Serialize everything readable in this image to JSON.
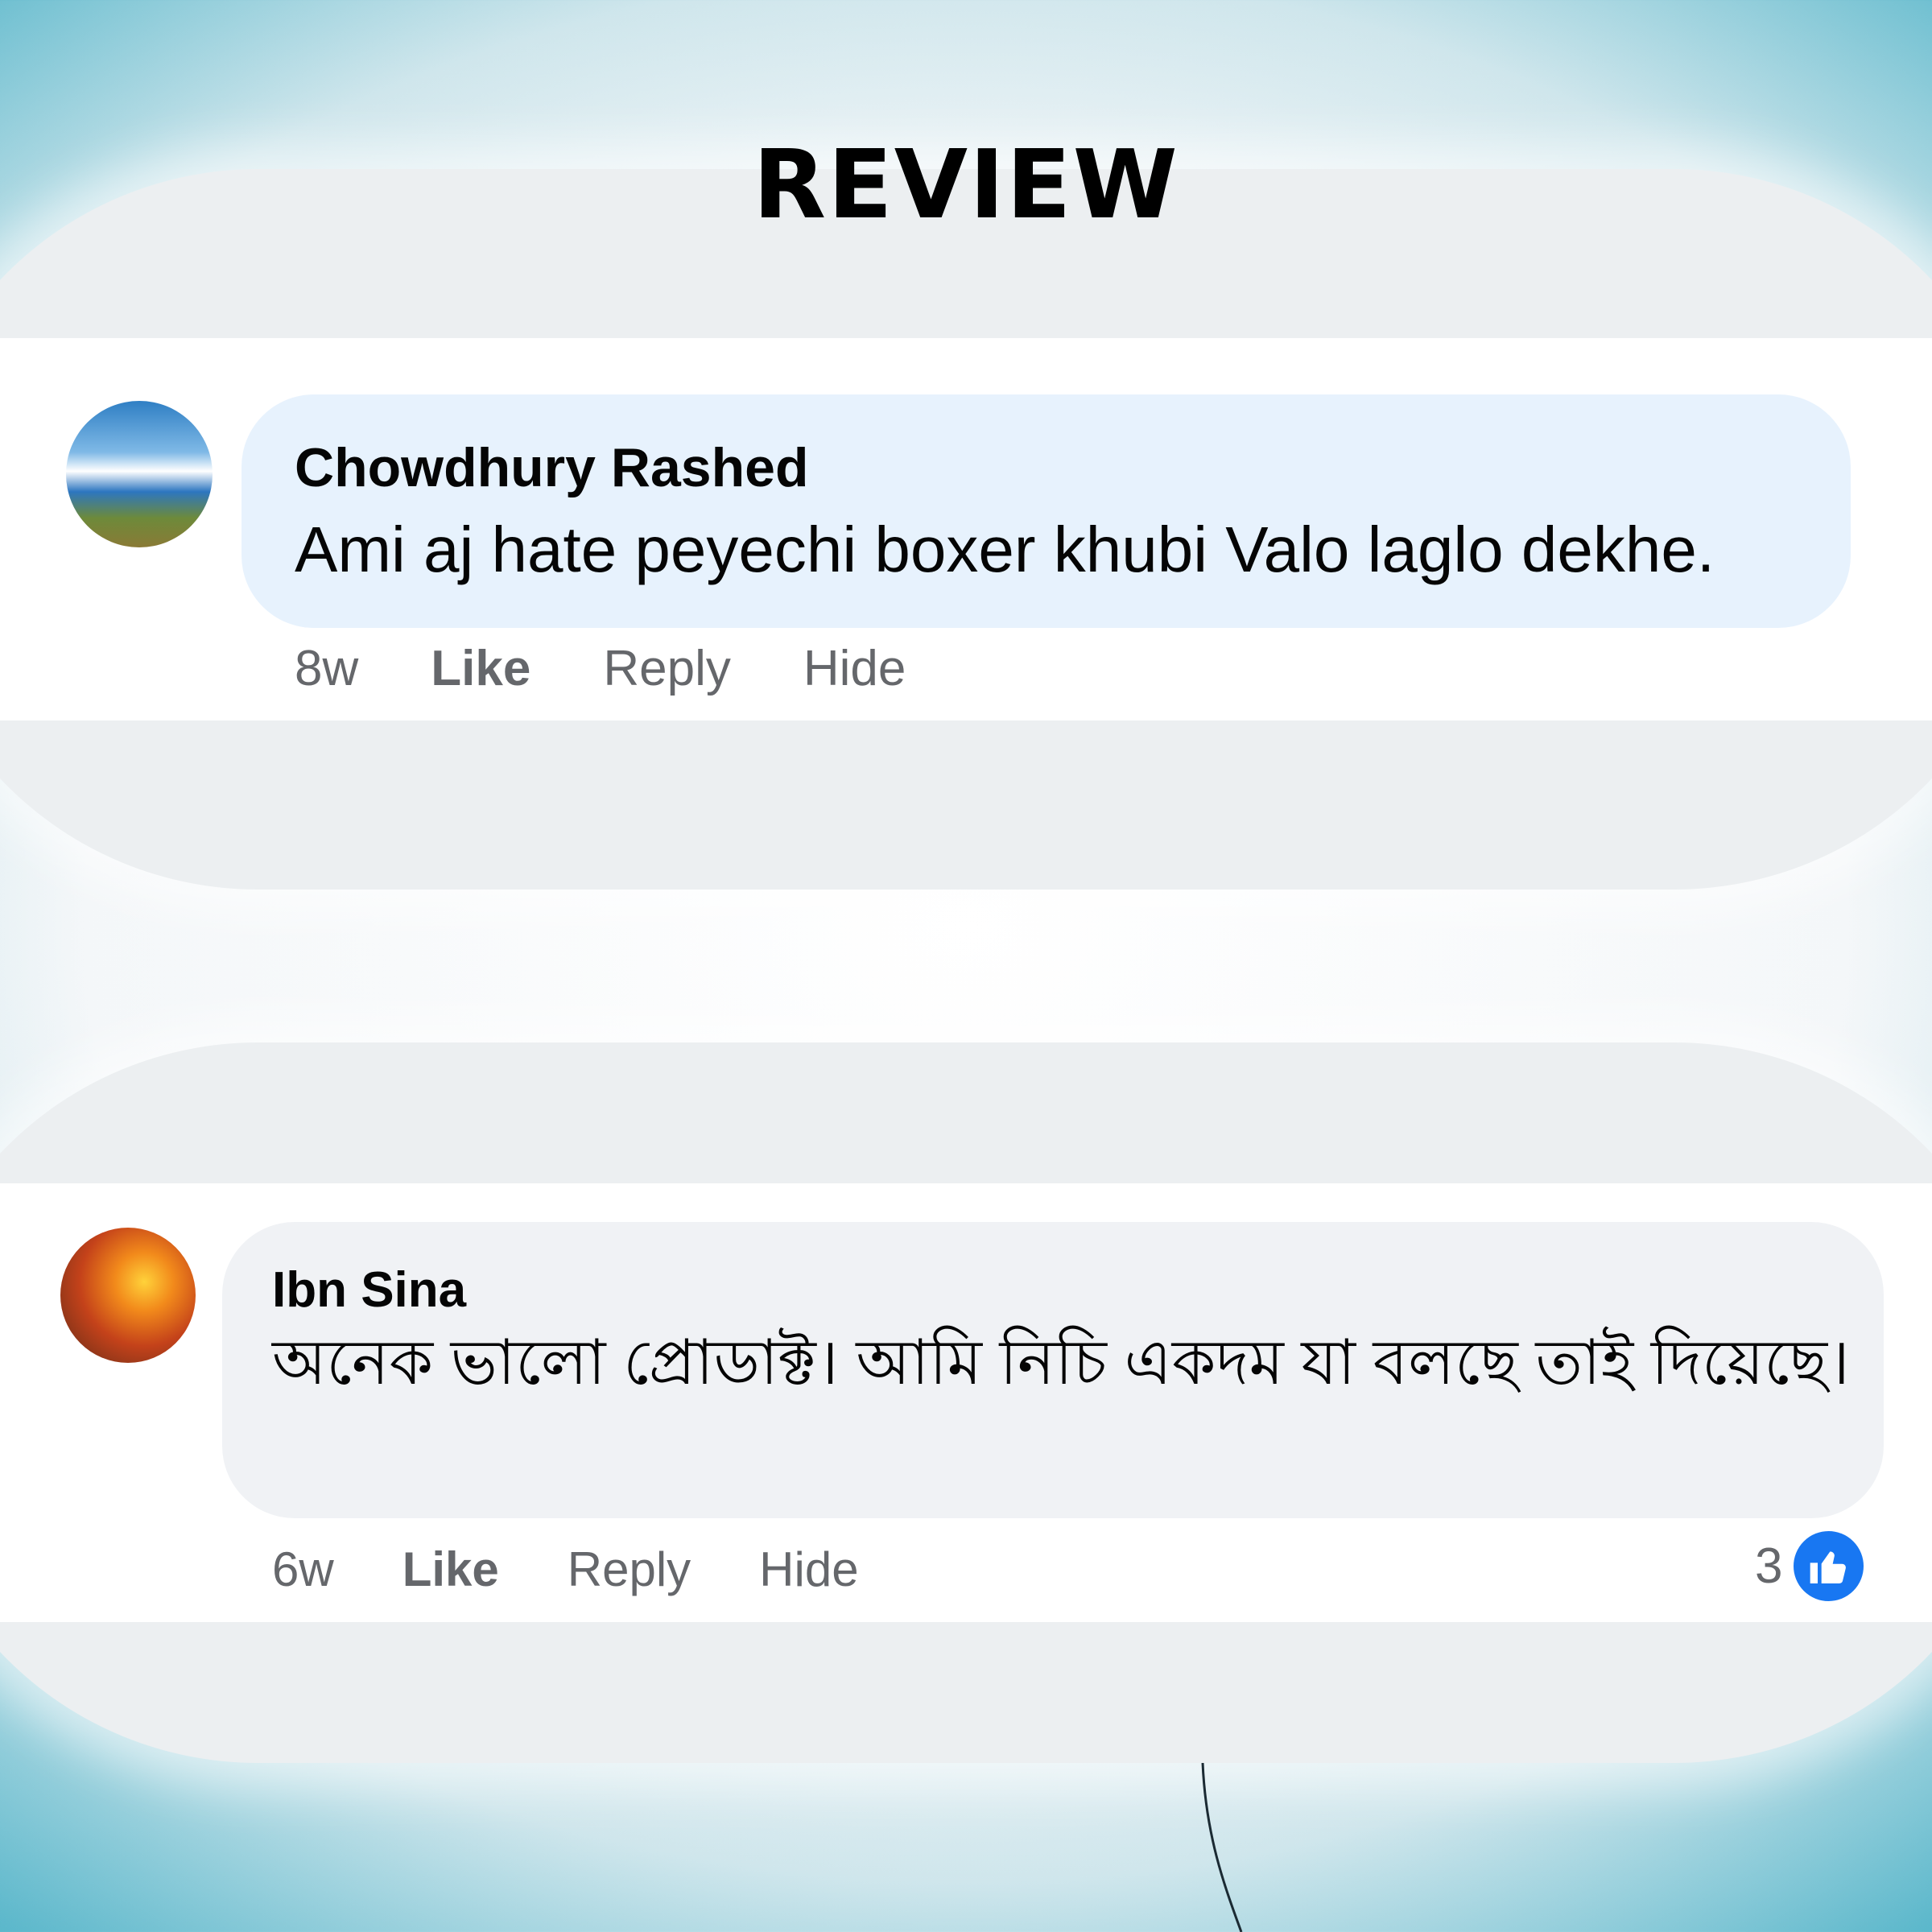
{
  "title": "REVIEW",
  "comments": [
    {
      "author": "Chowdhury Rashed",
      "text": "Ami aj hate peyechi boxer khubi Valo laglo dekhe.",
      "time": "8w",
      "like_label": "Like",
      "reply_label": "Reply",
      "hide_label": "Hide",
      "reactions": ""
    },
    {
      "author": "Ibn Sina",
      "text": "অনেক ভালো প্রোডাক্ট। আমি নিচি একদম যা বলছে তাই দিয়েছে।",
      "time": "6w",
      "like_label": "Like",
      "reply_label": "Reply",
      "hide_label": "Hide",
      "reactions": "3"
    }
  ],
  "icons": {
    "like_badge": "thumbs-up-icon"
  },
  "colors": {
    "background_teal": "#0a8ea8",
    "bubble_blue": "#e7f2fd",
    "bubble_gray": "#f0f2f5",
    "like_blue": "#1877f2",
    "muted_text": "#65676b"
  }
}
